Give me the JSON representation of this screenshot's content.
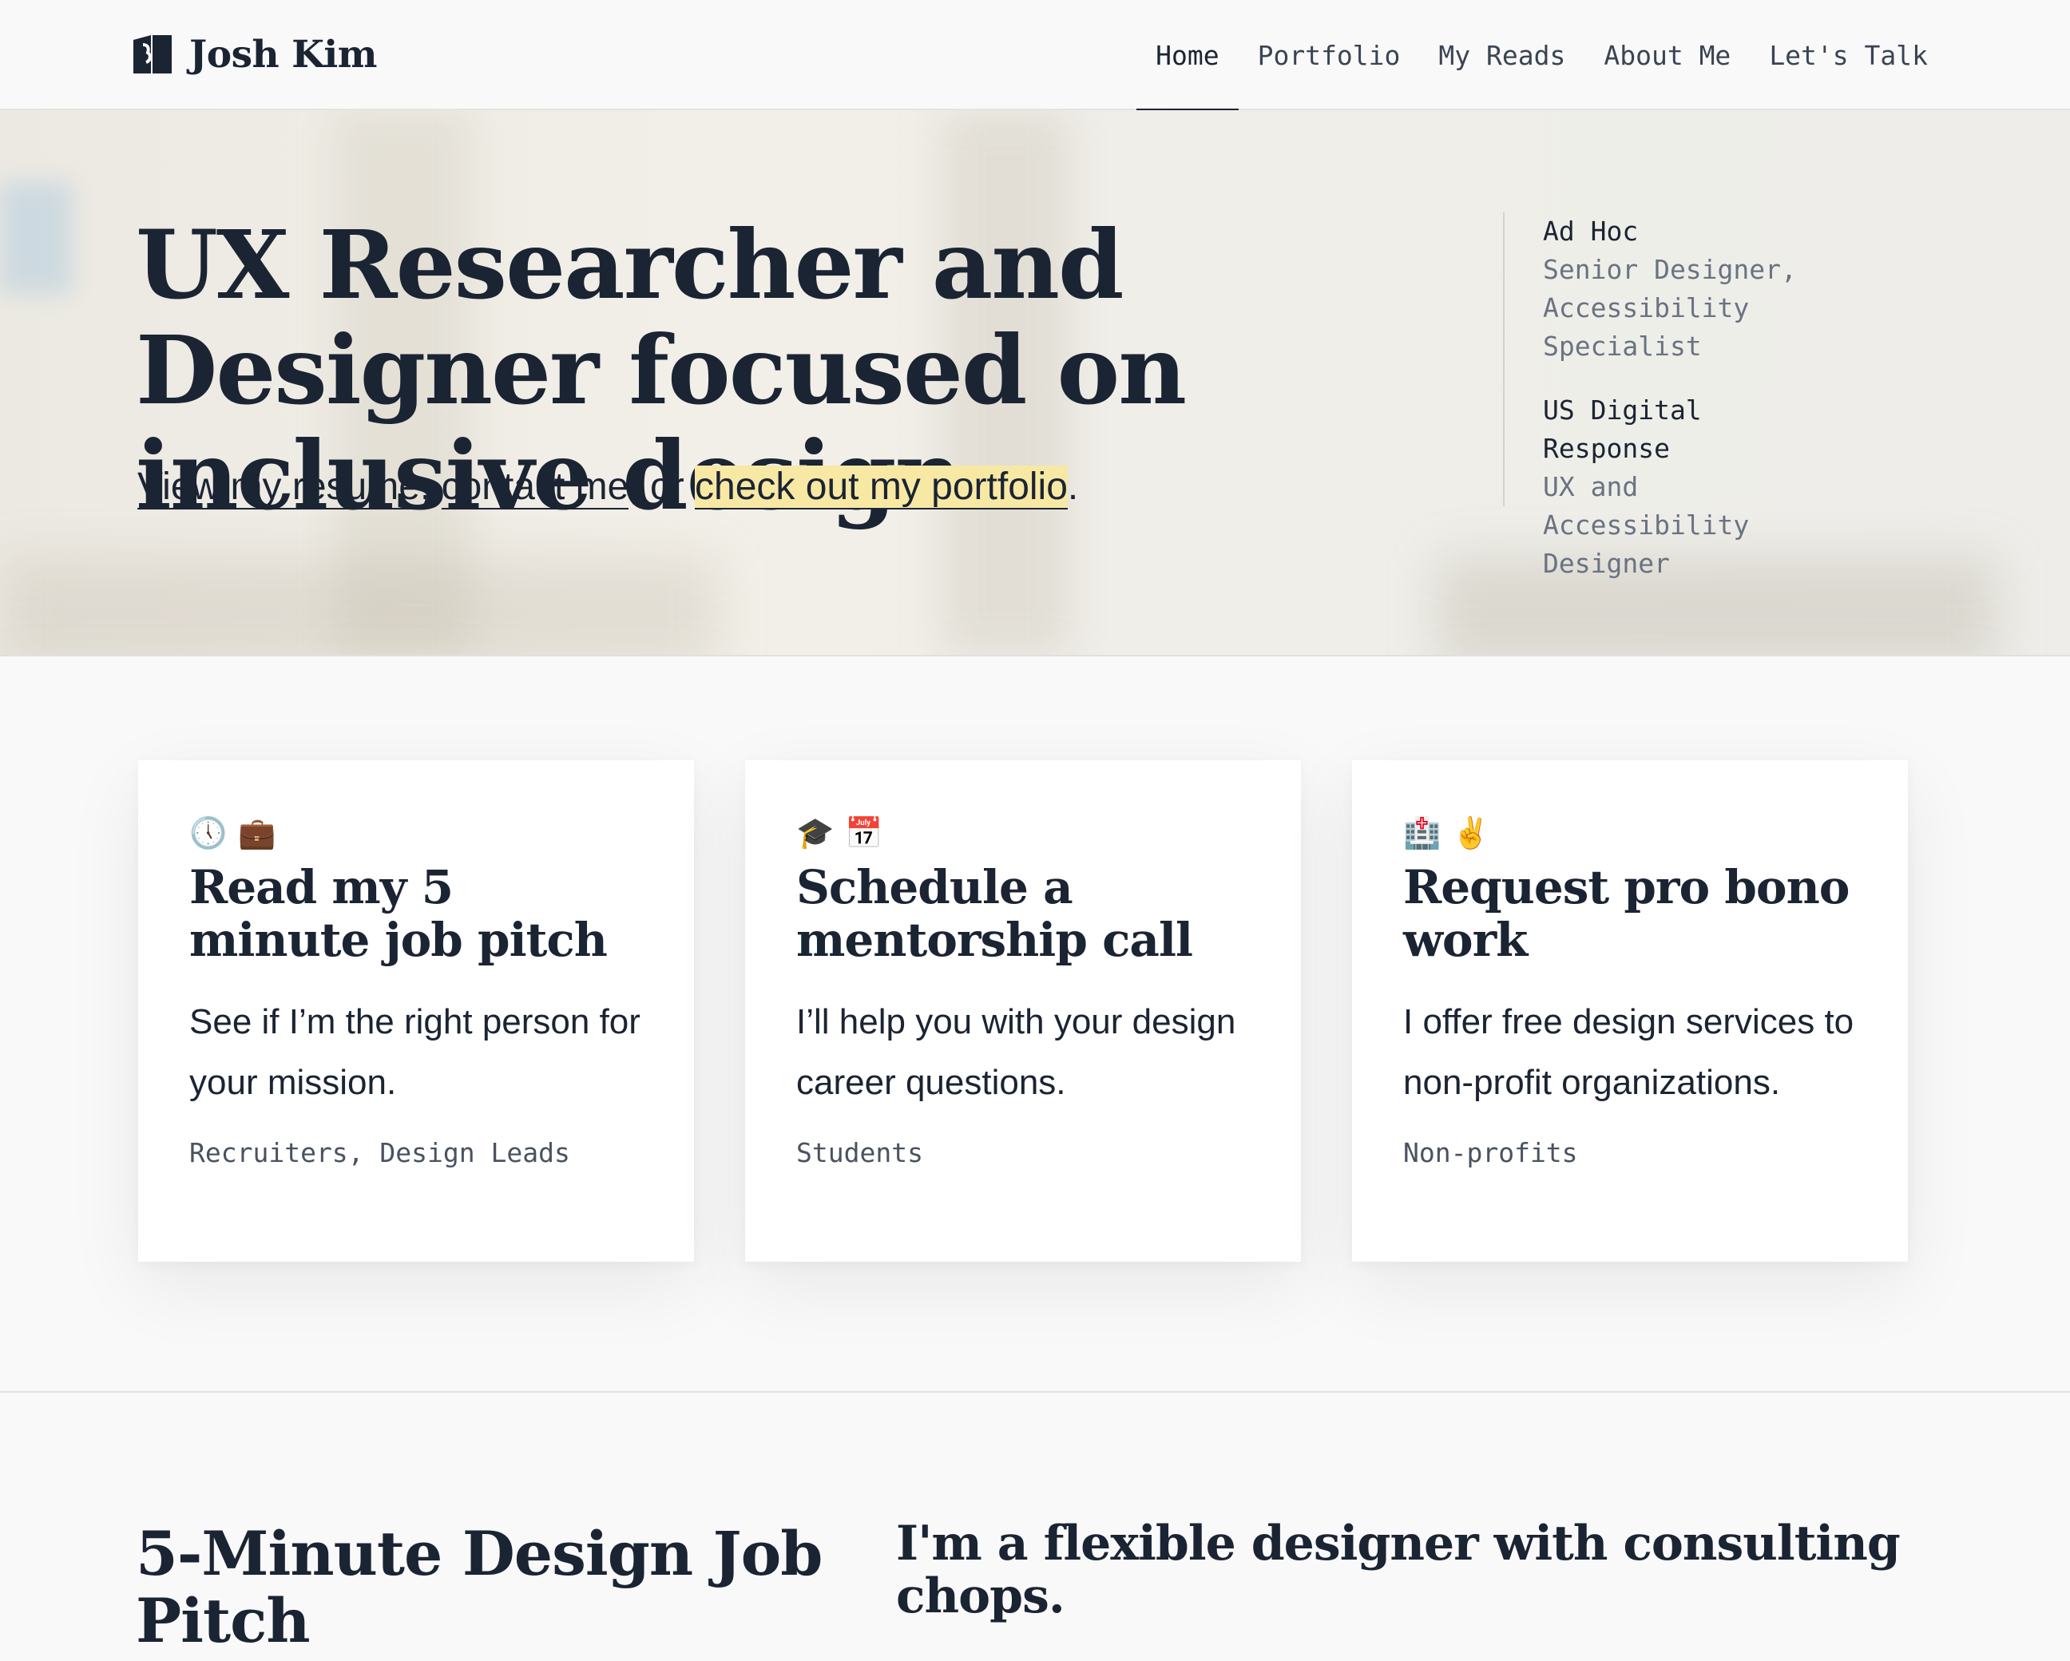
{
  "header": {
    "brand_name": "Josh Kim",
    "logo_icon": "book-logo-icon",
    "nav": [
      {
        "label": "Home",
        "active": true
      },
      {
        "label": "Portfolio"
      },
      {
        "label": "My Reads"
      },
      {
        "label": "About Me"
      },
      {
        "label": "Let's Talk"
      }
    ]
  },
  "hero": {
    "title": "UX Researcher and Designer focused on inclusive design",
    "links": {
      "resume": "View my resume",
      "sep1": ", ",
      "contact": "contact me",
      "sep2": ", or ",
      "portfolio": "check out my portfolio",
      "end": "."
    },
    "jobs": [
      {
        "org": "Ad Hoc",
        "role": "Senior Designer, Accessibility Specialist"
      },
      {
        "org": "US Digital Response",
        "role": "UX and Accessibility Designer"
      }
    ]
  },
  "cards": [
    {
      "emojis": [
        "🕔",
        "💼"
      ],
      "title": "Read my 5 minute job pitch",
      "description": "See if I’m the right person for your mission.",
      "tags": "Recruiters, Design Leads"
    },
    {
      "emojis": [
        "🎓",
        "📅"
      ],
      "title": "Schedule a mentorship call",
      "description": "I’ll help you with your design career questions.",
      "tags": "Students"
    },
    {
      "emojis": [
        "🏥",
        "✌️"
      ],
      "title": "Request pro bono work",
      "description": "I offer free design services to non-profit organizations.",
      "tags": "Non-profits"
    }
  ],
  "bottom": {
    "pitch_title": "5-Minute Design Job Pitch",
    "flex_title": "I'm a flexible designer with consulting chops."
  },
  "colors": {
    "text": "#1b2433",
    "muted": "#6a7380",
    "highlight": "#f7e8a4",
    "background": "#f9f9f9"
  }
}
